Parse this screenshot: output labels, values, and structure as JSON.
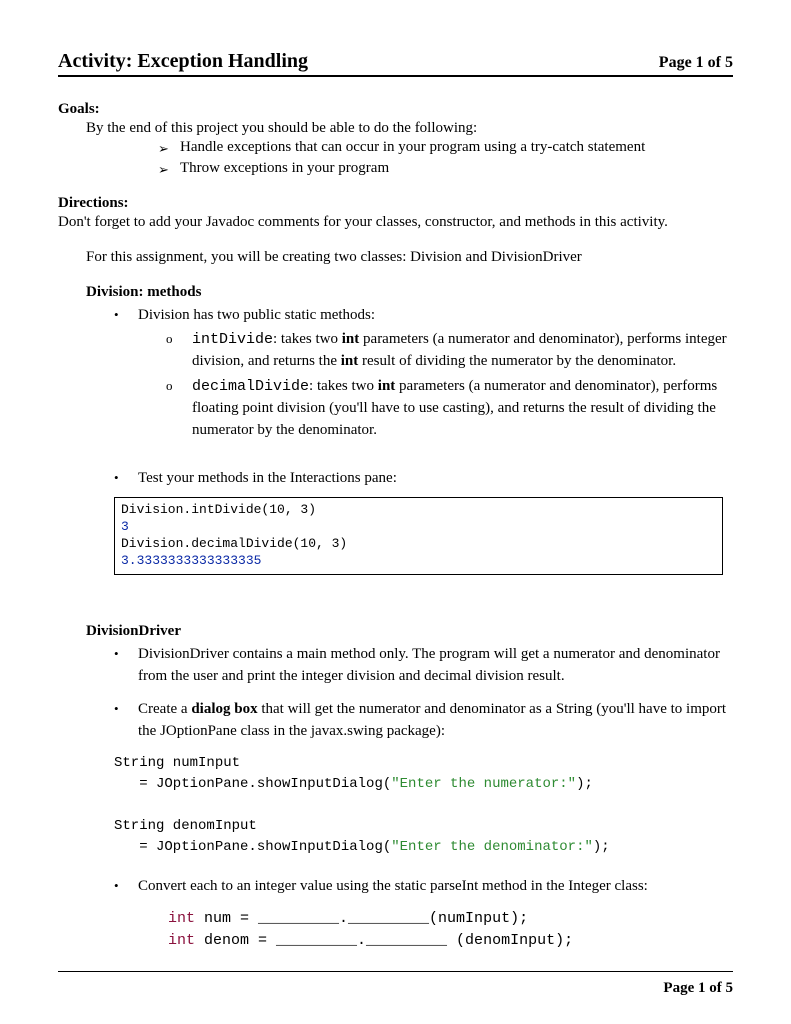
{
  "header": {
    "title": "Activity: Exception Handling",
    "page_label": "Page 1 of 5"
  },
  "goals": {
    "label": "Goals:",
    "intro": "By the end of this project you should be able to do the following:",
    "items": [
      "Handle exceptions that can occur in your program using a try-catch statement",
      "Throw exceptions in your program"
    ]
  },
  "directions": {
    "label": "Directions:",
    "javadoc": "Don't forget to add your Javadoc comments for your classes, constructor, and methods in this activity.",
    "assignment": "For this assignment, you will be creating two classes: Division and DivisionDriver"
  },
  "division": {
    "heading": "Division: methods",
    "intro": "Division has two public static methods:",
    "methods": [
      {
        "name": "intDivide",
        "desc_prefix": ": takes two ",
        "bold1": "int",
        "mid1": " parameters (a numerator and denominator), performs integer division, and returns the ",
        "bold2": "int",
        "mid2": " result of dividing the numerator by the denominator."
      },
      {
        "name": "decimalDivide",
        "desc_prefix": ": takes two ",
        "bold1": "int",
        "mid1": " parameters (a numerator and denominator), performs floating point division (you'll have to use casting), and returns the result of dividing the numerator by the denominator.",
        "bold2": "",
        "mid2": ""
      }
    ],
    "test_line": "Test your methods in the Interactions pane:",
    "codebox": {
      "l1": "Division.intDivide(10, 3)",
      "l2": "3",
      "l3": "Division.decimalDivide(10, 3)",
      "l4": "3.3333333333333335"
    }
  },
  "driver": {
    "heading": "DivisionDriver",
    "b1": "DivisionDriver contains a main method only. The program will get a numerator and denominator from the user and print the integer division and decimal division result.",
    "b2_pre": "Create a ",
    "b2_bold": "dialog box",
    "b2_post": " that will get the numerator and denominator as a String (you'll have to import the JOptionPane class in the javax.swing package):",
    "code": {
      "l1a": "String numInput",
      "l1b": "   = JOptionPane.showInputDialog(",
      "l1s": "\"Enter the numerator:\"",
      "l1c": ");",
      "l2a": "String denomInput",
      "l2b": "   = JOptionPane.showInputDialog(",
      "l2s": "\"Enter the denominator:\"",
      "l2c": ");"
    },
    "b3": "Convert each to an integer value using the static parseInt method in the Integer class:",
    "code2": {
      "kw": "int",
      "l1": " num = _________._________(numInput);",
      "l2": " denom = _________._________ (denomInput);"
    }
  },
  "footer": {
    "page_label": "Page 1 of 5"
  }
}
